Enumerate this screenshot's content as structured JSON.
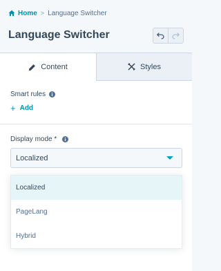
{
  "breadcrumb": {
    "home": "Home",
    "separator": ">",
    "current": "Language Switcher"
  },
  "header": {
    "title": "Language Switcher"
  },
  "tabs": [
    {
      "label": "Content",
      "icon": "pencil-icon",
      "active": true
    },
    {
      "label": "Styles",
      "icon": "styles-icon",
      "active": false
    }
  ],
  "smart_rules": {
    "label": "Smart rules",
    "add_label": "Add"
  },
  "display_mode": {
    "label": "Display mode *",
    "selected": "Localized",
    "options": [
      "Localized",
      "PageLang",
      "Hybrid"
    ]
  },
  "colors": {
    "link": "#0091ae",
    "text": "#33475b",
    "caret": "#00a4bd",
    "selected_bg": "#e5f5f8"
  }
}
